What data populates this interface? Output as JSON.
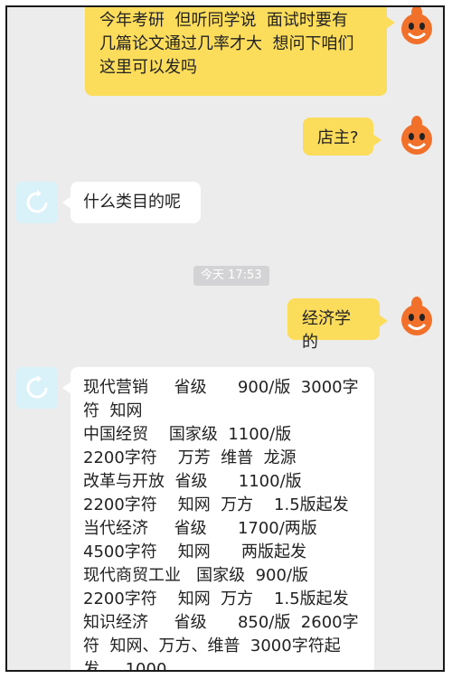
{
  "messages": {
    "m1": "今年考研  但听同学说  面试时要有\n几篇论文通过几率才大  想问下咱们\n这里可以发吗",
    "m2": "店主?",
    "m3": "什么类目的呢",
    "time": "今天 17:53",
    "m4": "经济学的",
    "m5": "现代营销     省级      900/版  3000字\n符  知网\n中国经贸    国家级  1100/版\n2200字符    万芳  维普  龙源\n改革与开放  省级      1100/版\n2200字符    知网  万方    1.5版起发\n当代经济     省级      1700/两版\n4500字符    知网      两版起发\n现代商贸工业   国家级  900/版\n2200字符    知网  万方    1.5版起发\n知识经济     省级      850/版  2600字\n符  知网、万方、维普  3000字符起\n发     1000"
  },
  "colors": {
    "outgoing_bubble": "#fbdc5b",
    "incoming_bubble": "#ffffff",
    "background": "#ececed"
  },
  "icons": {
    "shop_avatar": "orange-mascot-icon",
    "user_avatar": "refresh-circle-icon"
  }
}
